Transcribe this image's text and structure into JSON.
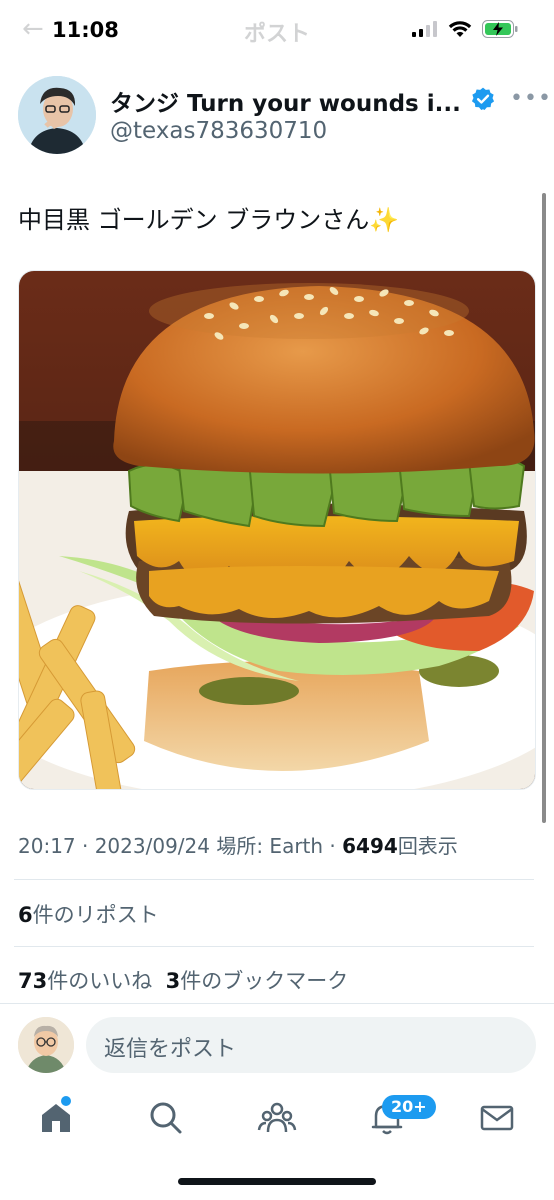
{
  "status_bar": {
    "time": "11:08",
    "icons": [
      "signal-icon",
      "wifi-icon",
      "battery-charging-icon"
    ]
  },
  "nav": {
    "back_icon": "back-arrow-icon",
    "title": "ポスト"
  },
  "post": {
    "author": {
      "display_name": "タンジ Turn your wounds i...",
      "handle": "@texas783630710",
      "verified": true
    },
    "text": "中目黒 ゴールデン ブラウンさん✨",
    "media": {
      "description_icon": "burger-photo"
    },
    "time": "20:17 · 2023/09/24 場所: Earth · ",
    "views_count": "6494",
    "views_label": "回表示",
    "reposts_count": "6",
    "reposts_label": "件のリポスト",
    "likes_count": "73",
    "likes_label": "件のいいね",
    "bookmarks_count": "3",
    "bookmarks_label": "件のブックマーク"
  },
  "reply": {
    "placeholder": "返信をポスト"
  },
  "tabbar": {
    "items": [
      "home-icon",
      "search-icon",
      "communities-icon",
      "notifications-icon",
      "messages-icon"
    ],
    "notifications_badge": "20+"
  },
  "colors": {
    "accent": "#1d9bf0",
    "secondary_text": "#536471"
  }
}
